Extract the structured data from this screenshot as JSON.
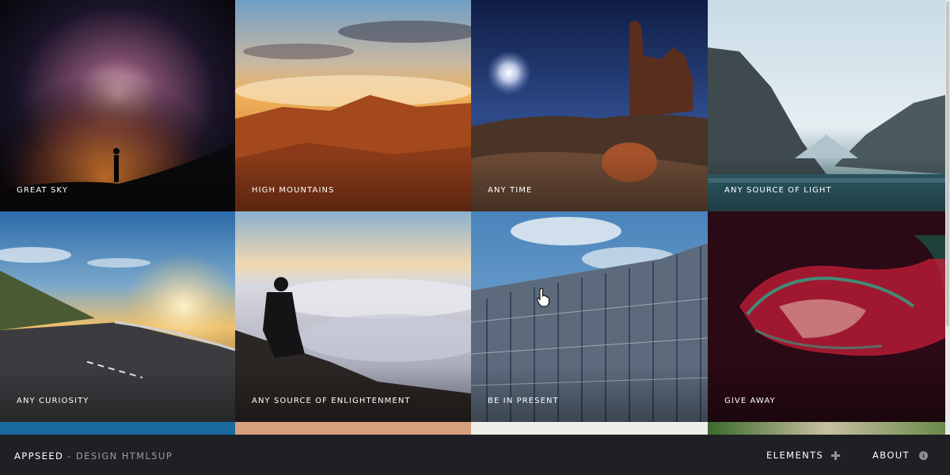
{
  "gallery": {
    "tiles": [
      {
        "caption": "Great Sky"
      },
      {
        "caption": "High Mountains"
      },
      {
        "caption": "Any Time"
      },
      {
        "caption": "Any Source of Light"
      },
      {
        "caption": "Any Curiosity"
      },
      {
        "caption": "Any Source of Enlightenment"
      },
      {
        "caption": "Be in Present"
      },
      {
        "caption": "Give Away"
      }
    ]
  },
  "footer": {
    "brand": "AppSeed",
    "separator": " - ",
    "credit": "Design HTML5UP",
    "nav": [
      {
        "label": "Elements",
        "icon": "plus-icon"
      },
      {
        "label": "About",
        "icon": "info-icon"
      }
    ]
  },
  "colors": {
    "footer_bg": "#1f2024",
    "credit_gray": "#9a9ca2"
  }
}
